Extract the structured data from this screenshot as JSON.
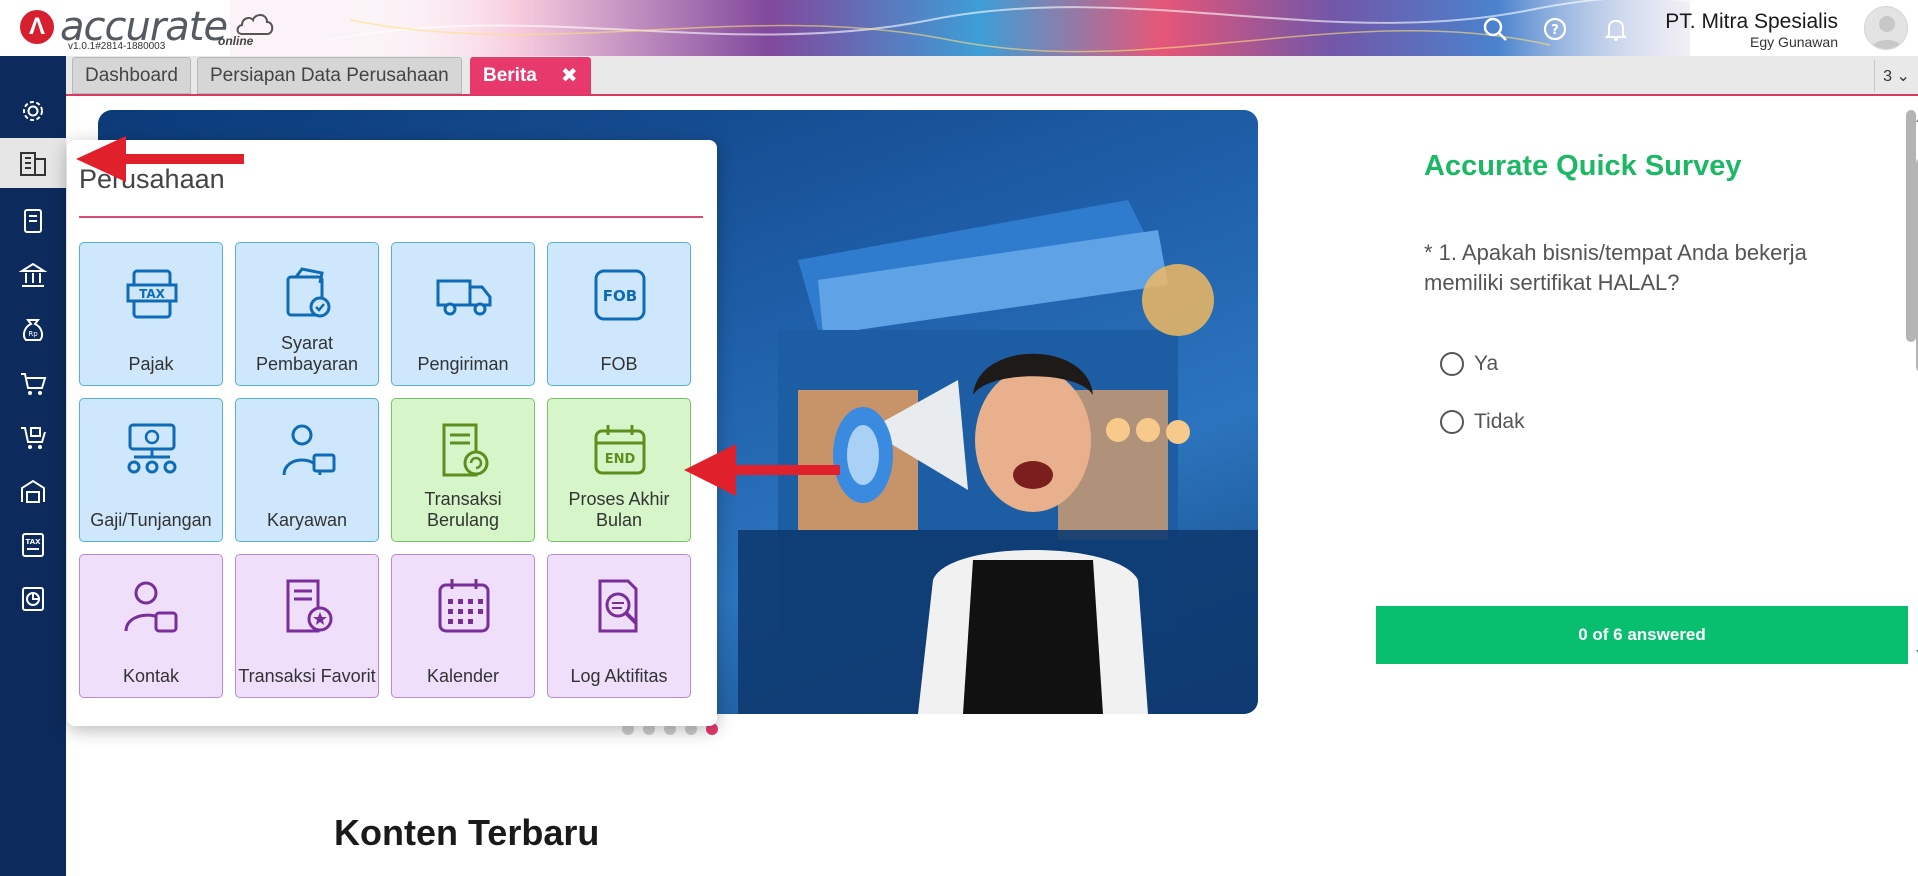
{
  "header": {
    "logo_text": "accurate",
    "logo_sub": "online",
    "version": "v1.0.1#2814-1880003",
    "company_name": "PT. Mitra Spesialis",
    "user_name": "Egy Gunawan",
    "icons": [
      "search-icon",
      "help-icon",
      "bell-icon"
    ]
  },
  "sidebar": {
    "items": [
      {
        "name": "gear-icon"
      },
      {
        "name": "building-icon",
        "active": true
      },
      {
        "name": "ledger-book-icon"
      },
      {
        "name": "bank-icon"
      },
      {
        "name": "money-bag-icon"
      },
      {
        "name": "shopping-cart-icon"
      },
      {
        "name": "cart-box-icon"
      },
      {
        "name": "warehouse-icon"
      },
      {
        "name": "tax-document-icon"
      },
      {
        "name": "report-chart-icon"
      }
    ]
  },
  "tabs": [
    {
      "label": "Dashboard",
      "active": false
    },
    {
      "label": "Persiapan Data Perusahaan",
      "active": false
    },
    {
      "label": "Berita",
      "active": true,
      "close": "✖"
    }
  ],
  "tab_count": "3 ⌄",
  "popup": {
    "title": "Perusahaan",
    "tiles": [
      {
        "label": "Pajak",
        "icon": "tax-icon",
        "color": "blue"
      },
      {
        "label": "Syarat Pembayaran",
        "icon": "payment-terms-icon",
        "color": "blue"
      },
      {
        "label": "Pengiriman",
        "icon": "delivery-truck-icon",
        "color": "blue"
      },
      {
        "label": "FOB",
        "icon": "fob-icon",
        "color": "blue"
      },
      {
        "label": "Gaji/Tunjangan",
        "icon": "salary-icon",
        "color": "blue"
      },
      {
        "label": "Karyawan",
        "icon": "employee-icon",
        "color": "blue"
      },
      {
        "label": "Transaksi Berulang",
        "icon": "recurring-transaction-icon",
        "color": "green"
      },
      {
        "label": "Proses Akhir Bulan",
        "icon": "end-of-month-icon",
        "color": "green"
      },
      {
        "label": "Kontak",
        "icon": "contact-icon",
        "color": "purple"
      },
      {
        "label": "Transaksi Favorit",
        "icon": "favorite-transaction-icon",
        "color": "purple"
      },
      {
        "label": "Kalender",
        "icon": "calendar-icon",
        "color": "purple"
      },
      {
        "label": "Log Aktifitas",
        "icon": "activity-log-icon",
        "color": "purple"
      }
    ]
  },
  "survey": {
    "title": "Accurate Quick Survey",
    "question": "* 1. Apakah bisnis/tempat Anda bekerja memiliki sertifikat HALAL?",
    "options": [
      "Ya",
      "Tidak"
    ],
    "progress": "0 of 6 answered"
  },
  "carousel": {
    "total": 5,
    "active": 5
  },
  "content": {
    "section_title": "Konten Terbaru"
  },
  "colors": {
    "sidebar": "#0c2a5b",
    "accent": "#e8396c",
    "survey_green": "#08be6f",
    "tile_blue": "#cfe7fc",
    "tile_green": "#d6f6c9",
    "tile_purple": "#efdffa",
    "annotation_arrow": "#e0202a"
  }
}
